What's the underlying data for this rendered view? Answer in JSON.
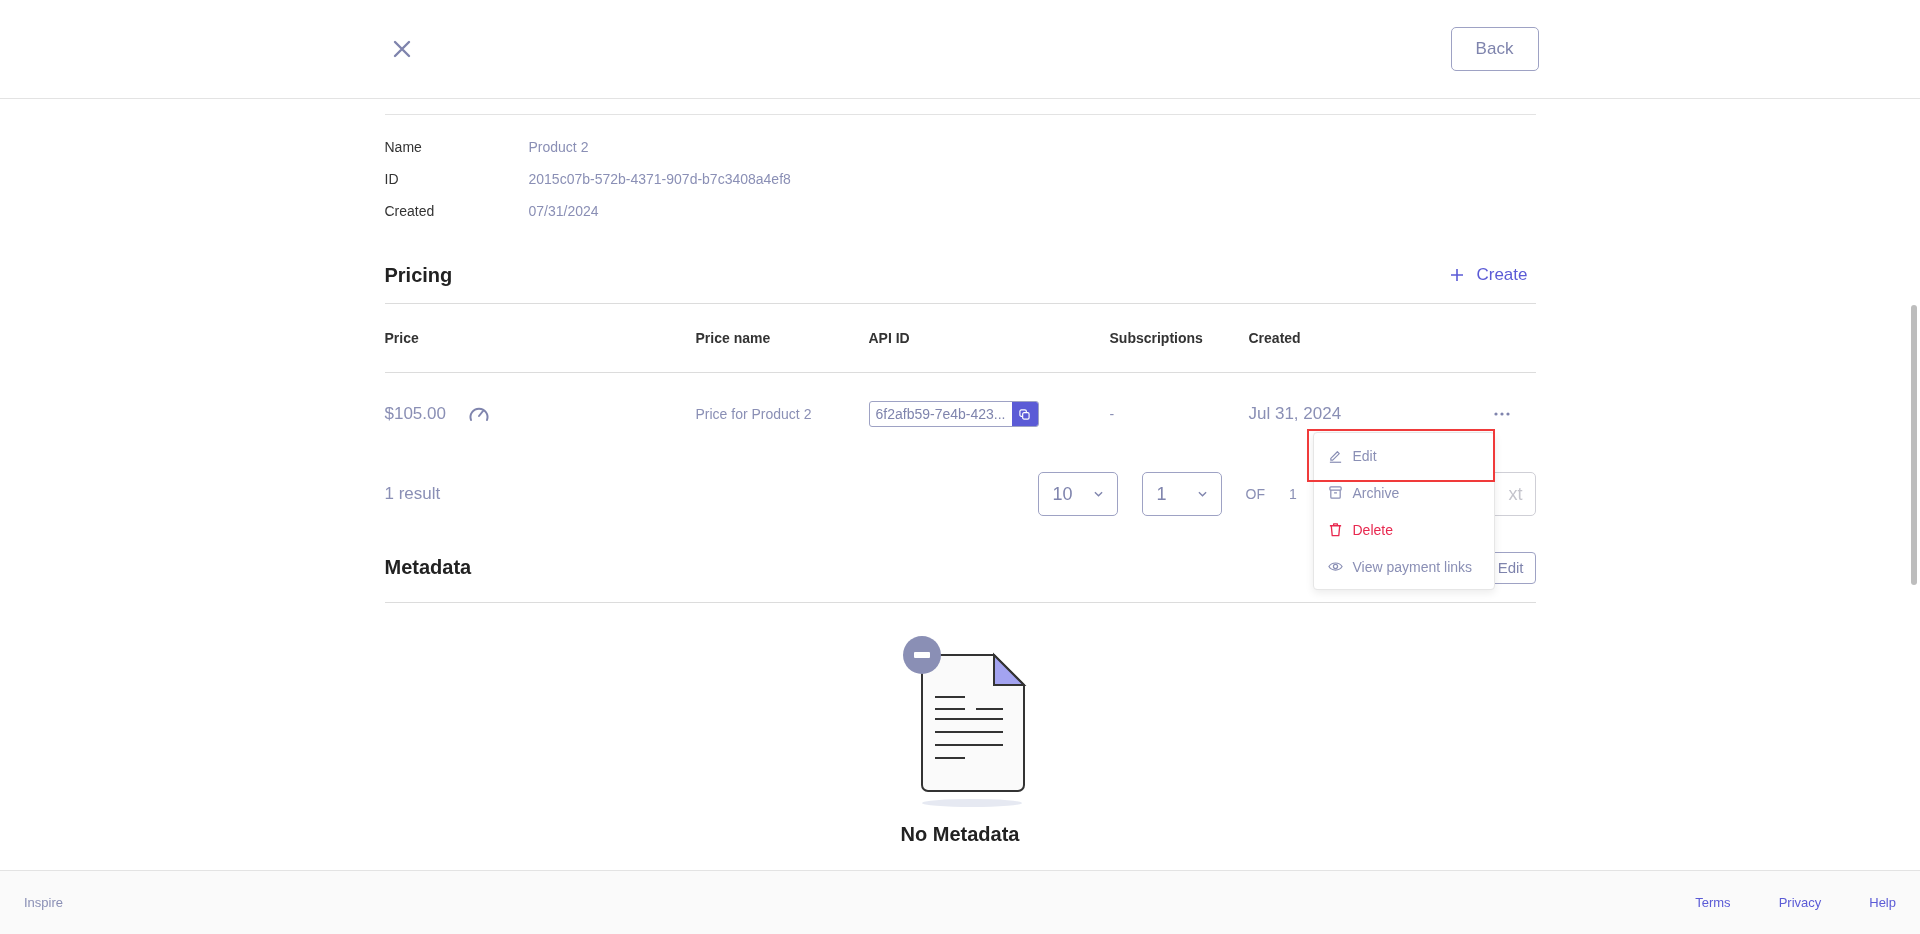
{
  "header": {
    "back_button": "Back"
  },
  "details": [
    {
      "label": "Name",
      "value": "Product 2"
    },
    {
      "label": "ID",
      "value": "2015c07b-572b-4371-907d-b7c3408a4ef8"
    },
    {
      "label": "Created",
      "value": "07/31/2024"
    }
  ],
  "pricing": {
    "title": "Pricing",
    "create_button": "Create",
    "columns": [
      "Price",
      "Price name",
      "API ID",
      "Subscriptions",
      "Created"
    ],
    "rows": [
      {
        "price": "$105.00",
        "price_name": "Price for Product 2",
        "api_id": "6f2afb59-7e4b-423...",
        "subscriptions": "-",
        "created": "Jul 31, 2024"
      }
    ],
    "result_count": "1 result",
    "page_size": "10",
    "page": "1",
    "of_label": "OF",
    "page_total": "1",
    "next_button": "xt"
  },
  "row_menu": {
    "items": [
      {
        "label": "Edit",
        "kind": "edit",
        "highlighted": true
      },
      {
        "label": "Archive",
        "kind": "archive",
        "highlighted": false
      },
      {
        "label": "Delete",
        "kind": "delete",
        "highlighted": false
      },
      {
        "label": "View payment links",
        "kind": "view",
        "highlighted": false
      }
    ]
  },
  "metadata": {
    "title": "Metadata",
    "edit_button": "Edit",
    "empty_text": "No Metadata"
  },
  "footer": {
    "brand": "Inspire",
    "links": [
      "Terms",
      "Privacy",
      "Help"
    ]
  }
}
